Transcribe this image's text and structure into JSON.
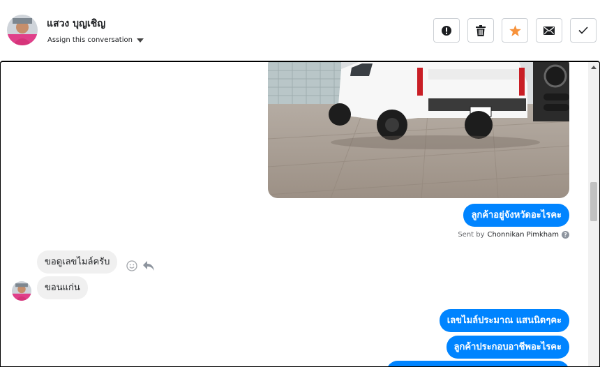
{
  "contact": {
    "name": "แสวง บุญเชิญ",
    "assign_label": "Assign this conversation"
  },
  "actions": [
    {
      "id": "spam",
      "icon": "alert-circle-icon"
    },
    {
      "id": "delete",
      "icon": "trash-icon"
    },
    {
      "id": "star",
      "icon": "star-icon",
      "color": "#f7923b"
    },
    {
      "id": "unread",
      "icon": "envelope-icon"
    },
    {
      "id": "done",
      "icon": "checkmark-icon"
    }
  ],
  "messages": {
    "out_1": "ลูกค้าอยู่จังหวัดอะไรคะ",
    "sent_by_prefix": "Sent by",
    "sent_by_name": "Chonnikan Pimkham",
    "in_1": "ขอดูเลขไมล์ครับ",
    "in_2": "ขอนแก่น",
    "out_2": "เลขไมล์ประมาณ แสนนิดๆคะ",
    "out_3": "ลูกค้าประกอบอาชีพอะไรคะ"
  },
  "colors": {
    "accent": "#0084ff",
    "star": "#f7923b",
    "incoming_bg": "#f0f0f0"
  }
}
